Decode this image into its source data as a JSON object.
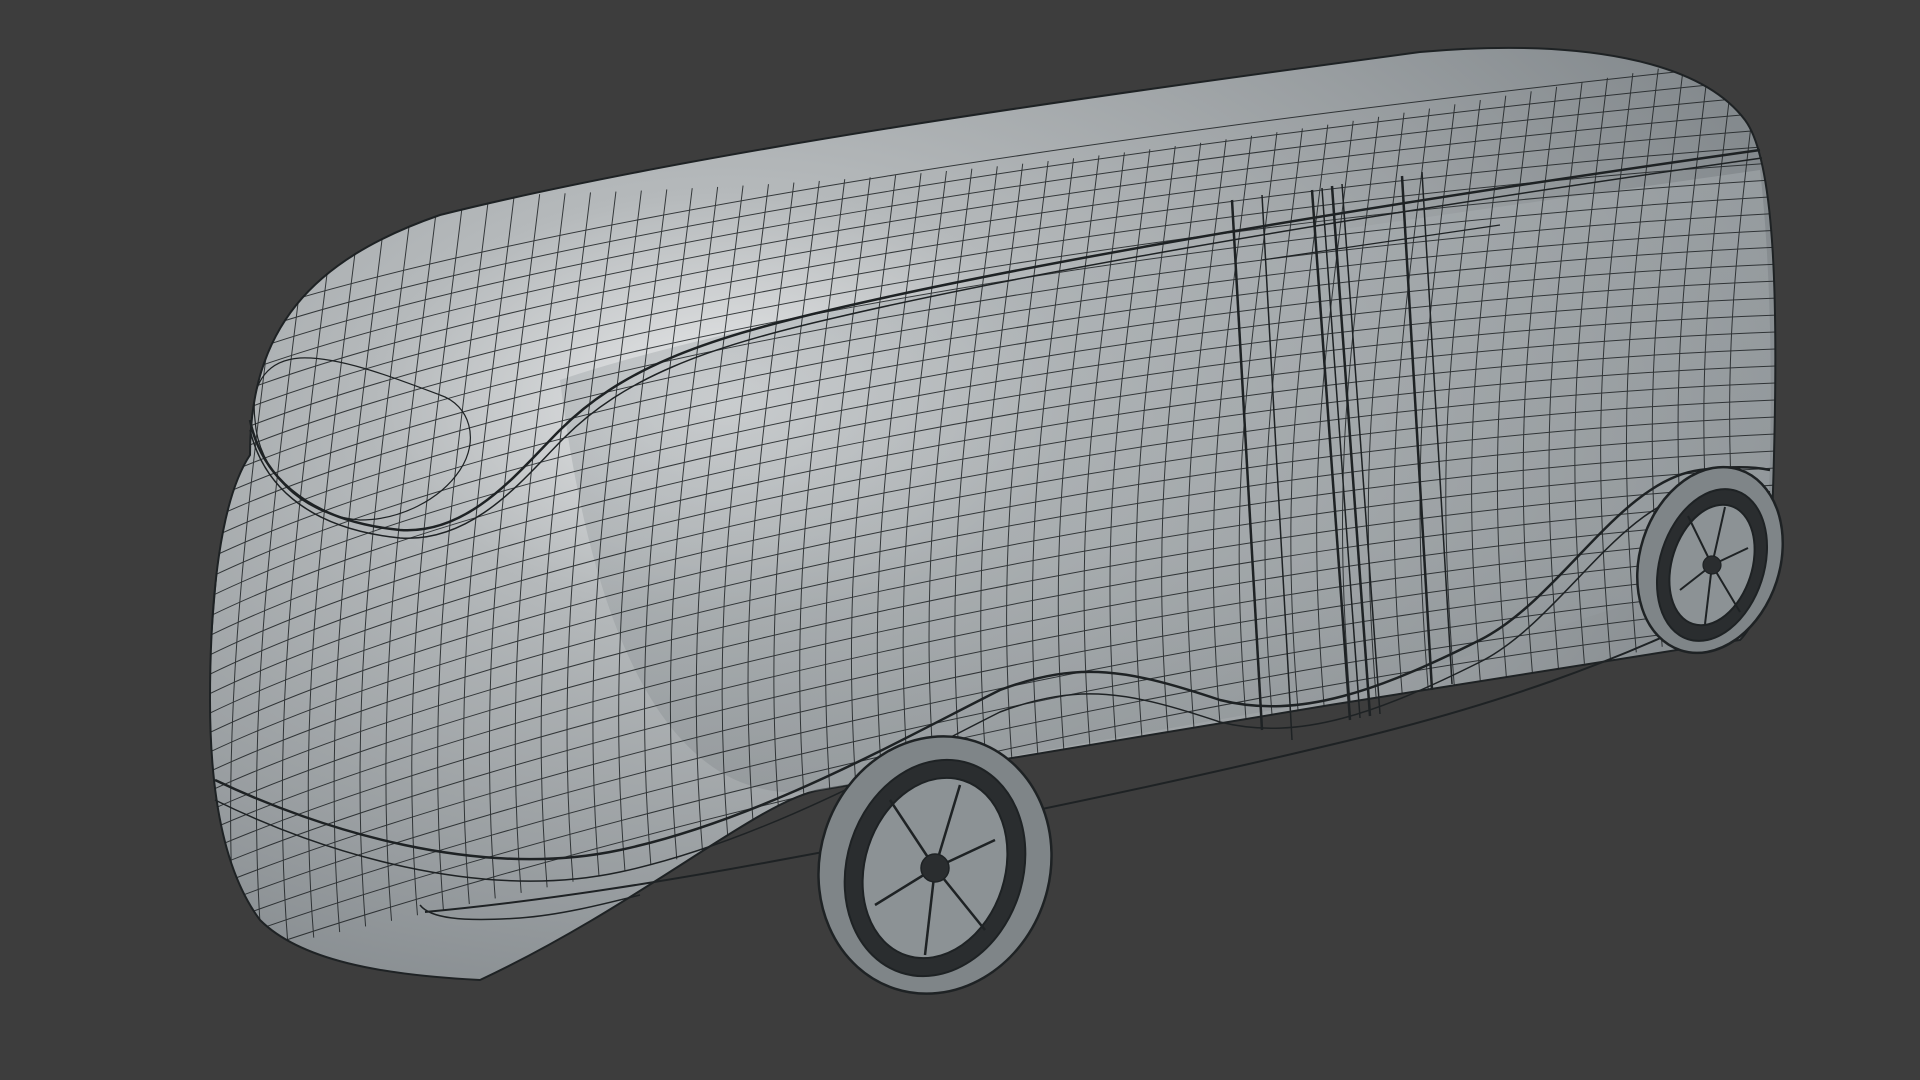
{
  "viewport": {
    "background_color": "#3d3d3d",
    "object": {
      "kind": "bus",
      "display_mode": "wireframe-over-solid",
      "surface_color": "#9fa4a7",
      "wire_color": "#1e2224"
    }
  }
}
